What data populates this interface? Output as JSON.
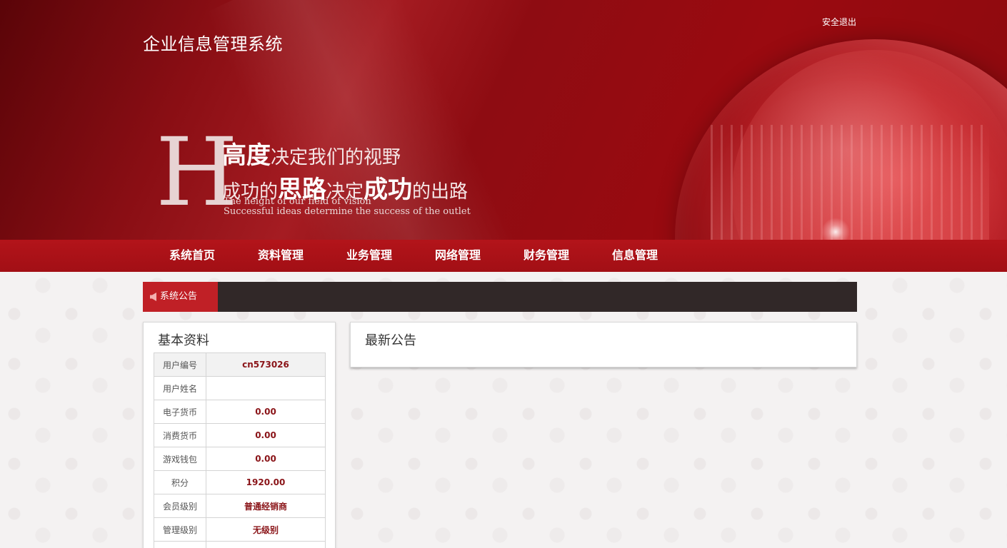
{
  "header": {
    "site_title": "企业信息管理系统",
    "logout_label": "安全退出"
  },
  "slogan": {
    "big_letter": "H",
    "line1_strong": "高度",
    "line1_rest": "决定我们的视野",
    "line2_a": "成功的",
    "line2_strong1": "思路",
    "line2_b": "决定",
    "line2_strong2": "成功",
    "line2_c": "的出路",
    "english_1": "The height of our field of vision",
    "english_2": "Successful ideas determine the success of the outlet"
  },
  "nav": {
    "items": [
      {
        "label": "系统首页"
      },
      {
        "label": "资料管理"
      },
      {
        "label": "业务管理"
      },
      {
        "label": "网络管理"
      },
      {
        "label": "财务管理"
      },
      {
        "label": "信息管理"
      }
    ]
  },
  "notice_bar": {
    "label": "系统公告",
    "icon": "speaker-icon"
  },
  "basic_info": {
    "title": "基本资料",
    "rows": [
      {
        "key": "用户编号",
        "value": "cn573026"
      },
      {
        "key": "用户姓名",
        "value": ""
      },
      {
        "key": "电子货币",
        "value": "0.00"
      },
      {
        "key": "消费货币",
        "value": "0.00"
      },
      {
        "key": "游戏钱包",
        "value": "0.00"
      },
      {
        "key": "积分",
        "value": "1920.00"
      },
      {
        "key": "会员级别",
        "value": "普通经销商"
      },
      {
        "key": "管理级别",
        "value": "无级别"
      },
      {
        "key": "",
        "value": ""
      }
    ]
  },
  "latest_notice": {
    "title": "最新公告"
  },
  "colors": {
    "brand_red": "#a20f15",
    "notice_tag_red": "#c02026",
    "notice_bar_dark": "#312828",
    "value_text": "#8a1418"
  }
}
